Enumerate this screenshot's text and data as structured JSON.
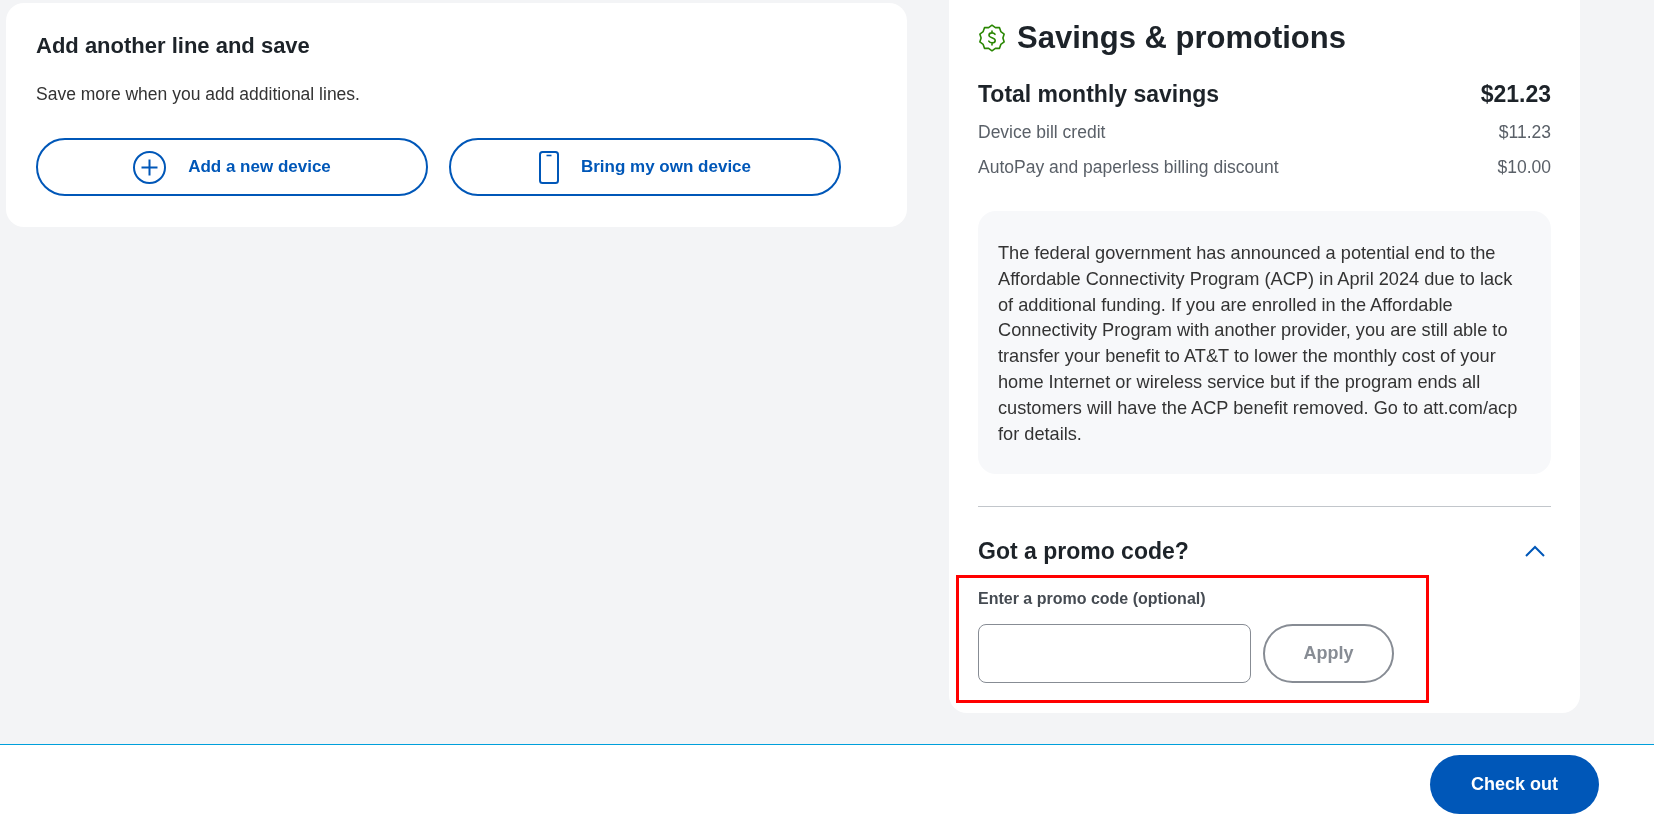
{
  "add_line_card": {
    "title": "Add another line and save",
    "subtitle": "Save more when you add additional lines.",
    "buttons": [
      {
        "label": "Add a new device",
        "kind": "add"
      },
      {
        "label": "Bring my own device",
        "kind": "phone"
      }
    ]
  },
  "savings": {
    "title": "Savings & promotions",
    "total": {
      "label": "Total monthly savings",
      "amount": "$21.23"
    },
    "items": [
      {
        "label": "Device bill credit",
        "amount": "$11.23"
      },
      {
        "label": "AutoPay and paperless billing discount",
        "amount": "$10.00"
      }
    ],
    "notice": "The federal government has announced a potential end to the Affordable Connectivity Program (ACP) in April 2024 due to lack of additional funding. If you are enrolled in the Affordable Connectivity Program with another provider, you are still able to transfer your benefit to AT&T to lower the monthly cost of your home Internet or wireless service but if the program ends all customers will have the ACP benefit removed. Go to att.com/acp for details."
  },
  "promo": {
    "title": "Got a promo code?",
    "expanded": true,
    "highlighted": true,
    "field_label": "Enter a promo code (optional)",
    "apply_button": {
      "label": "Apply",
      "disabled": true
    }
  },
  "footer": {
    "checkout_button": "Check out"
  }
}
